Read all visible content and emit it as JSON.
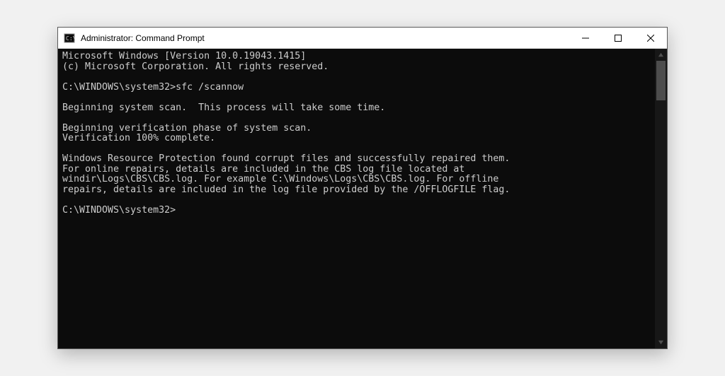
{
  "titlebar": {
    "title": "Administrator: Command Prompt"
  },
  "terminal": {
    "lines": [
      "Microsoft Windows [Version 10.0.19043.1415]",
      "(c) Microsoft Corporation. All rights reserved.",
      "",
      "C:\\WINDOWS\\system32>sfc /scannow",
      "",
      "Beginning system scan.  This process will take some time.",
      "",
      "Beginning verification phase of system scan.",
      "Verification 100% complete.",
      "",
      "Windows Resource Protection found corrupt files and successfully repaired them.",
      "For online repairs, details are included in the CBS log file located at",
      "windir\\Logs\\CBS\\CBS.log. For example C:\\Windows\\Logs\\CBS\\CBS.log. For offline",
      "repairs, details are included in the log file provided by the /OFFLOGFILE flag.",
      ""
    ],
    "current_prompt": "C:\\WINDOWS\\system32>"
  }
}
